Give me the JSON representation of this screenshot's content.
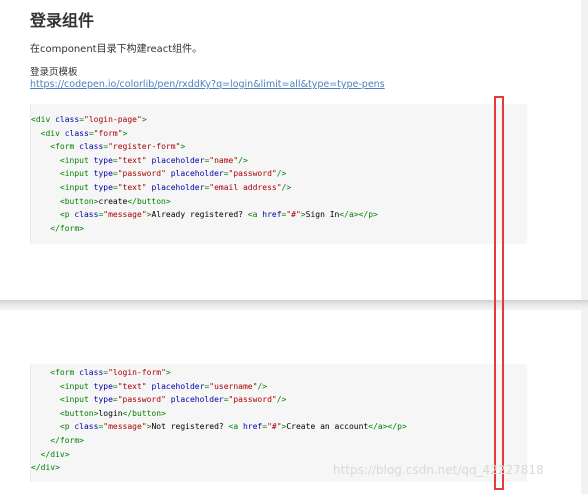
{
  "heading": "登录组件",
  "paragraph": "在component目录下构建react组件。",
  "template_label": "登录页模板",
  "template_link": "https://codepen.io/colorlib/pen/rxddKy?q=login&limit=all&type=type-pens",
  "code_block_1": [
    [
      {
        "t": "tag",
        "v": "<div "
      },
      {
        "t": "attr",
        "v": "class"
      },
      {
        "t": "tag",
        "v": "="
      },
      {
        "t": "str",
        "v": "\"login-page\""
      },
      {
        "t": "tag",
        "v": ">"
      }
    ],
    [
      {
        "t": "txt",
        "v": "  "
      },
      {
        "t": "tag",
        "v": "<div "
      },
      {
        "t": "attr",
        "v": "class"
      },
      {
        "t": "tag",
        "v": "="
      },
      {
        "t": "str",
        "v": "\"form\""
      },
      {
        "t": "tag",
        "v": ">"
      }
    ],
    [
      {
        "t": "txt",
        "v": "    "
      },
      {
        "t": "tag",
        "v": "<form "
      },
      {
        "t": "attr",
        "v": "class"
      },
      {
        "t": "tag",
        "v": "="
      },
      {
        "t": "str",
        "v": "\"register-form\""
      },
      {
        "t": "tag",
        "v": ">"
      }
    ],
    [
      {
        "t": "txt",
        "v": "      "
      },
      {
        "t": "tag",
        "v": "<input "
      },
      {
        "t": "attr",
        "v": "type"
      },
      {
        "t": "tag",
        "v": "="
      },
      {
        "t": "str",
        "v": "\"text\""
      },
      {
        "t": "txt",
        "v": " "
      },
      {
        "t": "attr",
        "v": "placeholder"
      },
      {
        "t": "tag",
        "v": "="
      },
      {
        "t": "str",
        "v": "\"name\""
      },
      {
        "t": "tag",
        "v": "/>"
      }
    ],
    [
      {
        "t": "txt",
        "v": "      "
      },
      {
        "t": "tag",
        "v": "<input "
      },
      {
        "t": "attr",
        "v": "type"
      },
      {
        "t": "tag",
        "v": "="
      },
      {
        "t": "str",
        "v": "\"password\""
      },
      {
        "t": "txt",
        "v": " "
      },
      {
        "t": "attr",
        "v": "placeholder"
      },
      {
        "t": "tag",
        "v": "="
      },
      {
        "t": "str",
        "v": "\"password\""
      },
      {
        "t": "tag",
        "v": "/>"
      }
    ],
    [
      {
        "t": "txt",
        "v": "      "
      },
      {
        "t": "tag",
        "v": "<input "
      },
      {
        "t": "attr",
        "v": "type"
      },
      {
        "t": "tag",
        "v": "="
      },
      {
        "t": "str",
        "v": "\"text\""
      },
      {
        "t": "txt",
        "v": " "
      },
      {
        "t": "attr",
        "v": "placeholder"
      },
      {
        "t": "tag",
        "v": "="
      },
      {
        "t": "str",
        "v": "\"email address\""
      },
      {
        "t": "tag",
        "v": "/>"
      }
    ],
    [
      {
        "t": "txt",
        "v": "      "
      },
      {
        "t": "tag",
        "v": "<button>"
      },
      {
        "t": "txt",
        "v": "create"
      },
      {
        "t": "tag",
        "v": "</button>"
      }
    ],
    [
      {
        "t": "txt",
        "v": "      "
      },
      {
        "t": "tag",
        "v": "<p "
      },
      {
        "t": "attr",
        "v": "class"
      },
      {
        "t": "tag",
        "v": "="
      },
      {
        "t": "str",
        "v": "\"message\""
      },
      {
        "t": "tag",
        "v": ">"
      },
      {
        "t": "txt",
        "v": "Already registered? "
      },
      {
        "t": "tag",
        "v": "<a "
      },
      {
        "t": "attr",
        "v": "href"
      },
      {
        "t": "tag",
        "v": "="
      },
      {
        "t": "str",
        "v": "\"#\""
      },
      {
        "t": "tag",
        "v": ">"
      },
      {
        "t": "txt",
        "v": "Sign In"
      },
      {
        "t": "tag",
        "v": "</a></p>"
      }
    ],
    [
      {
        "t": "txt",
        "v": "    "
      },
      {
        "t": "tag",
        "v": "</form>"
      }
    ]
  ],
  "code_block_2": [
    [
      {
        "t": "txt",
        "v": "    "
      },
      {
        "t": "tag",
        "v": "<form "
      },
      {
        "t": "attr",
        "v": "class"
      },
      {
        "t": "tag",
        "v": "="
      },
      {
        "t": "str",
        "v": "\"login-form\""
      },
      {
        "t": "tag",
        "v": ">"
      }
    ],
    [
      {
        "t": "txt",
        "v": "      "
      },
      {
        "t": "tag",
        "v": "<input "
      },
      {
        "t": "attr",
        "v": "type"
      },
      {
        "t": "tag",
        "v": "="
      },
      {
        "t": "str",
        "v": "\"text\""
      },
      {
        "t": "txt",
        "v": " "
      },
      {
        "t": "attr",
        "v": "placeholder"
      },
      {
        "t": "tag",
        "v": "="
      },
      {
        "t": "str",
        "v": "\"username\""
      },
      {
        "t": "tag",
        "v": "/>"
      }
    ],
    [
      {
        "t": "txt",
        "v": "      "
      },
      {
        "t": "tag",
        "v": "<input "
      },
      {
        "t": "attr",
        "v": "type"
      },
      {
        "t": "tag",
        "v": "="
      },
      {
        "t": "str",
        "v": "\"password\""
      },
      {
        "t": "txt",
        "v": " "
      },
      {
        "t": "attr",
        "v": "placeholder"
      },
      {
        "t": "tag",
        "v": "="
      },
      {
        "t": "str",
        "v": "\"password\""
      },
      {
        "t": "tag",
        "v": "/>"
      }
    ],
    [
      {
        "t": "txt",
        "v": "      "
      },
      {
        "t": "tag",
        "v": "<button>"
      },
      {
        "t": "txt",
        "v": "login"
      },
      {
        "t": "tag",
        "v": "</button>"
      }
    ],
    [
      {
        "t": "txt",
        "v": "      "
      },
      {
        "t": "tag",
        "v": "<p "
      },
      {
        "t": "attr",
        "v": "class"
      },
      {
        "t": "tag",
        "v": "="
      },
      {
        "t": "str",
        "v": "\"message\""
      },
      {
        "t": "tag",
        "v": ">"
      },
      {
        "t": "txt",
        "v": "Not registered? "
      },
      {
        "t": "tag",
        "v": "<a "
      },
      {
        "t": "attr",
        "v": "href"
      },
      {
        "t": "tag",
        "v": "="
      },
      {
        "t": "str",
        "v": "\"#\""
      },
      {
        "t": "tag",
        "v": ">"
      },
      {
        "t": "txt",
        "v": "Create an account"
      },
      {
        "t": "tag",
        "v": "</a></p>"
      }
    ],
    [
      {
        "t": "txt",
        "v": "    "
      },
      {
        "t": "tag",
        "v": "</form>"
      }
    ],
    [
      {
        "t": "txt",
        "v": "  "
      },
      {
        "t": "tag",
        "v": "</div>"
      }
    ],
    [
      {
        "t": "tag",
        "v": "</div>"
      }
    ]
  ],
  "watermark": "https://blog.csdn.net/qq_42227818",
  "colors": {
    "tag": "#008000",
    "attribute": "#0000aa",
    "string": "#aa0000",
    "highlight_border": "#e53a3a",
    "link": "#4a7fc0"
  }
}
